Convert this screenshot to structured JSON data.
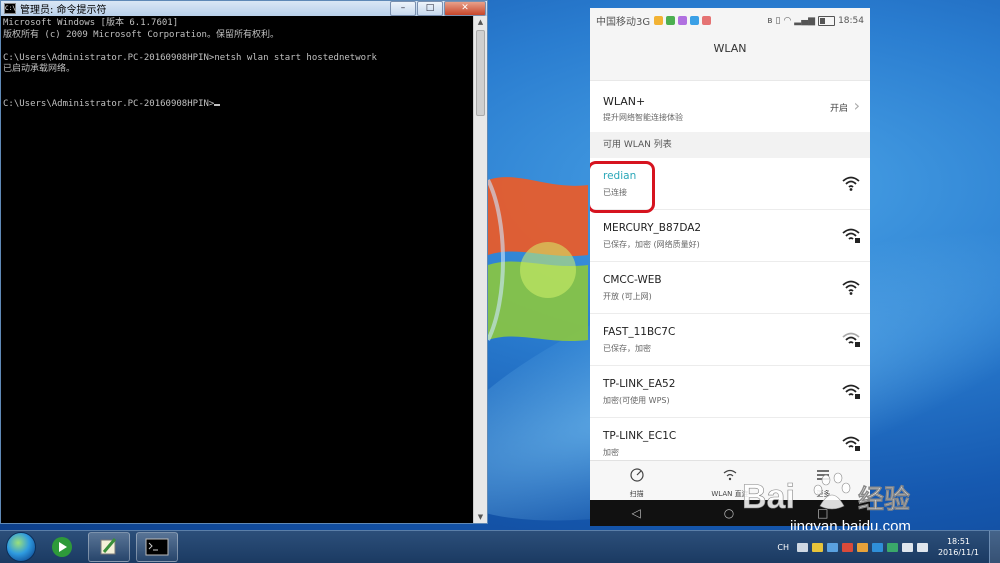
{
  "cmd": {
    "title": "管理员: 命令提示符",
    "lines": [
      "Microsoft Windows [版本 6.1.7601]",
      "版权所有 (c) 2009 Microsoft Corporation。保留所有权利。",
      "",
      "C:\\Users\\Administrator.PC-20160908HPIN>netsh wlan start hostednetwork",
      "已启动承载网络。",
      "",
      "",
      "C:\\Users\\Administrator.PC-20160908HPIN>"
    ],
    "minimize": "–",
    "maximize": "□",
    "close": "✕"
  },
  "phone": {
    "carrier": "中国移动3G",
    "time": "18:54",
    "header": "WLAN",
    "wlanplus": {
      "title": "WLAN+",
      "subtitle": "提升网络智能连接体验",
      "value": "开启"
    },
    "section_label": "可用 WLAN 列表",
    "networks": [
      {
        "name": "redian",
        "status": "已连接"
      },
      {
        "name": "MERCURY_B87DA2",
        "status": "已保存，加密 (网络质量好)"
      },
      {
        "name": "CMCC-WEB",
        "status": "开放 (可上网)"
      },
      {
        "name": "FAST_11BC7C",
        "status": "已保存，加密"
      },
      {
        "name": "TP-LINK_EA52",
        "status": "加密(可使用 WPS)"
      },
      {
        "name": "TP-LINK_EC1C",
        "status": "加密"
      }
    ],
    "bottom": {
      "scan": "扫描",
      "direct": "WLAN 直连",
      "more": "更多"
    }
  },
  "watermark": {
    "text": "Bai 经验",
    "url": "jingyan.baidu.com"
  },
  "taskbar": {
    "lang": "CH",
    "time": "18:51",
    "date": "2016/11/1"
  },
  "colors": {
    "connected": "#2aa7b8",
    "highlight": "#d6131f"
  }
}
